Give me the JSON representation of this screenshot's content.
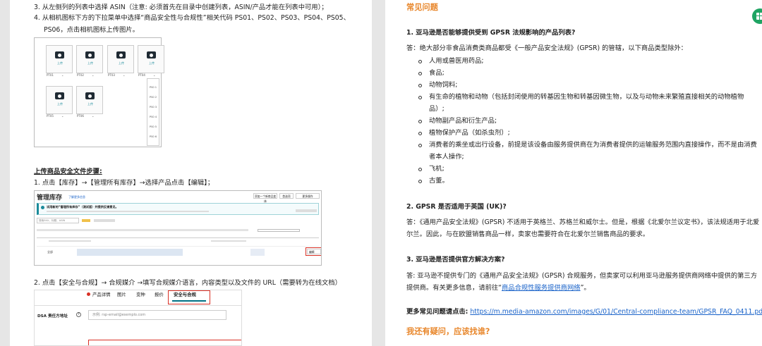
{
  "left": {
    "step3": "3. 从左侧列的列表中选择 ASIN（注意: 必须首先在目录中创建列表，ASIN/产品才能在列表中可用）；",
    "step4_line1": "4. 从相机图标下方的下拉菜单中选择“商品安全性与合规性”相关代码 PS01、PS02、PS03、PS04、PS05、",
    "step4_line2": "PS06，点击相机图标上传图片。",
    "photo_grid": {
      "upload_label": "上传",
      "codes": [
        "PT01",
        "PT02",
        "PT03",
        "PT04",
        "PT05",
        "PT06"
      ],
      "dropdown_options": [
        "PS0 1",
        "PS0 2",
        "PS0 3",
        "PS0 4",
        "PS0 5",
        "PS0 6"
      ]
    },
    "upload_heading": "上传商品安全文件步骤:",
    "upload_step1": "1. 点击【库存】→【管理所有库存】→选择产品点击【编辑】；",
    "inventory": {
      "title": "管理库存",
      "subtitle": "了解更多信息",
      "buttons": [
        "添加一个新商品变体",
        "首选项",
        "更多操作"
      ],
      "notice": "试用新的“管理所有库存”（测试版）并提供反馈意见。",
      "search_placeholder": "搜索SKU、标题、ASIN",
      "row_label": "全部",
      "edit_label": "编辑"
    },
    "upload_step2": "2. 点击【安全与合规】→ 合规媒介 →填写合规媒介语言，内容类型以及文件的 URL（需要转为在线文档）",
    "compliance": {
      "tabs": [
        "产品详情",
        "图片",
        "变种",
        "报价",
        "安全与合规"
      ],
      "field_label": "DSA 责任方地址",
      "field_placeholder": "示例: rsp-email@esemplo.com"
    }
  },
  "right": {
    "faq_title": "常见问题",
    "q1": "1. 亚马逊是否能够提供受到 GPSR 法规影响的产品列表?",
    "a1_intro": "答：绝大部分非食品消费类商品都受《一般产品安全法规》(GPSR) 的管辖，以下商品类型除外：",
    "exclusions": [
      [
        "人用或兽医用药品;"
      ],
      [
        "食品;"
      ],
      [
        "动物饲料;"
      ],
      [
        "有生命的植物和动物（包括封闭使用的转基因生物和转基因微生物，以及与动物未来繁殖直接相关的动物植物",
        "品）;"
      ],
      [
        "动物副产品和衍生产品;"
      ],
      [
        "植物保护产品（如杀虫剂）;"
      ],
      [
        "消费者的乘坐或出行设备，前提是该设备由服务提供商在为消费者提供的运输服务范围内直接操作，而不是由消费",
        "者本人操作;"
      ],
      [
        "飞机;"
      ],
      [
        "古董。"
      ]
    ],
    "q2": "2. GPSR 是否适用于英国 (UK)?",
    "a2_line1": "答：《通用产品安全法规》(GPSR) 不适用于英格兰、苏格兰和威尔士。但是，根据《北爱尔兰议定书》，该法规适用于北爱",
    "a2_line2": "尔兰。因此，与在欧盟销售商品一样，卖家也需要符合在北爱尔兰销售商品的要求。",
    "q3": "3. 亚马逊是否提供官方解决方案?",
    "a3_line1": "答: 亚马逊不提供专门的《通用产品安全法规》(GPSR) 合规服务，但卖家可以利用亚马逊服务提供商网络中提供的第三方",
    "a3_line2_prefix": "提供商。有关更多信息，请前往“",
    "a3_link": "商品合规性服务提供商网络",
    "a3_line2_suffix": "”。",
    "more_faq_label": "更多常见问题请点击:",
    "more_faq_url": "https://m.media-amazon.com/images/G/01/Central-compliance-team/GPSR_FAQ_0411.pdf",
    "contact_title": "我还有疑问，应该找谁?"
  },
  "colors": {
    "accent": "#e8862a",
    "link": "#1a63c9",
    "highlight": "#d93025",
    "sheets": "#1fa463"
  },
  "icons": [
    "camera-icon",
    "sheets-icon",
    "chevron-down-icon",
    "warning-icon"
  ]
}
